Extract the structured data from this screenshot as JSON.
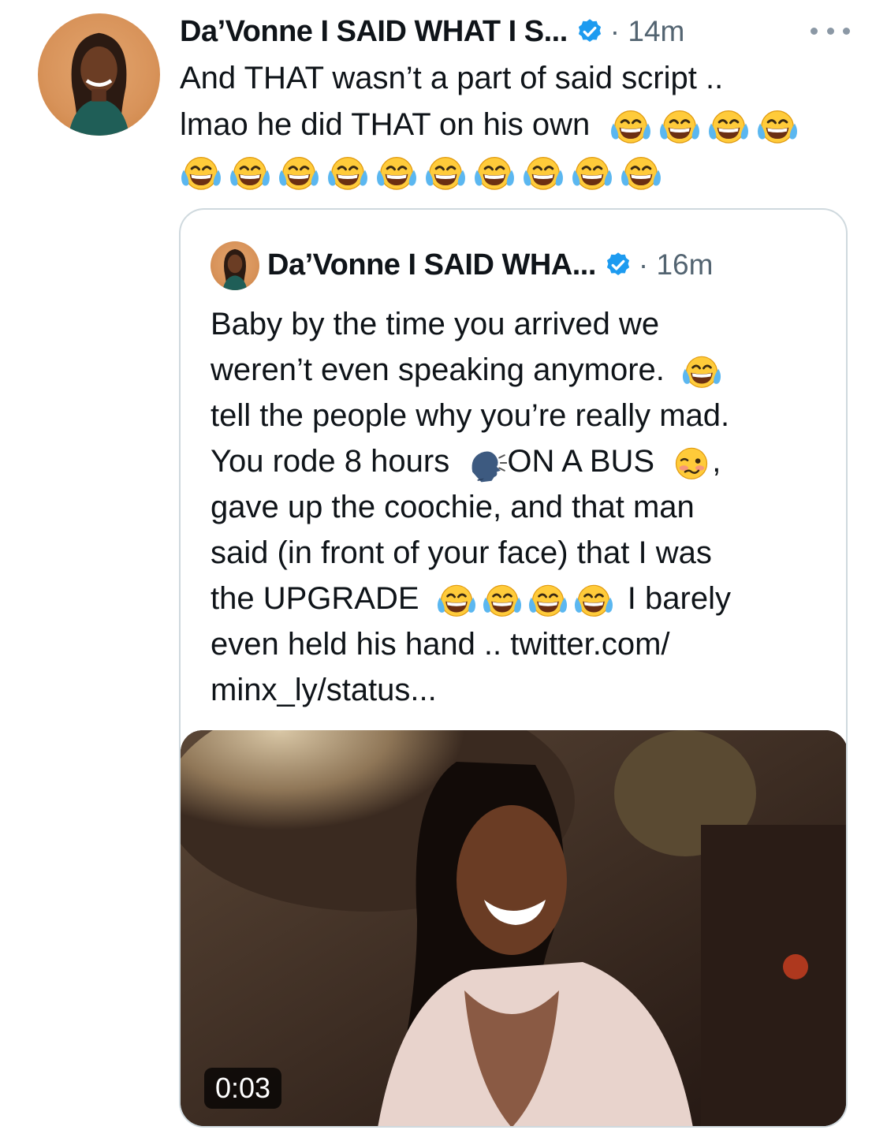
{
  "tweet": {
    "author_name": "Da’Vonne I SAID WHAT I S...",
    "time": "· 14m",
    "more_icon": "more-icon",
    "text_lines": [
      "And THAT wasn’t a part of said script ..",
      "lmao he did THAT on his own"
    ],
    "emoji": "face-with-tears-of-joy"
  },
  "quote": {
    "author_name": "Da’Vonne I SAID WHA...",
    "time": "· 16m",
    "text": {
      "l1": "Baby by the time you arrived we",
      "l2": "weren’t even speaking anymore.",
      "l3": "tell the people why you’re really mad.",
      "l4a": "You rode 8 hours",
      "l4b": "ON A BUS",
      "l4c": ",",
      "l5": "gave up the coochie, and that man",
      "l6": "said (in front of your face) that I was",
      "l7a": "the UPGRADE",
      "l7b": "I barely",
      "l8": "even held his hand .. twitter.com/",
      "l9": "minx_ly/status..."
    },
    "media": {
      "type": "video",
      "duration": "0:03"
    }
  },
  "colors": {
    "verified": "#1d9bf0",
    "meta": "#536471",
    "border": "#cfd9de"
  }
}
